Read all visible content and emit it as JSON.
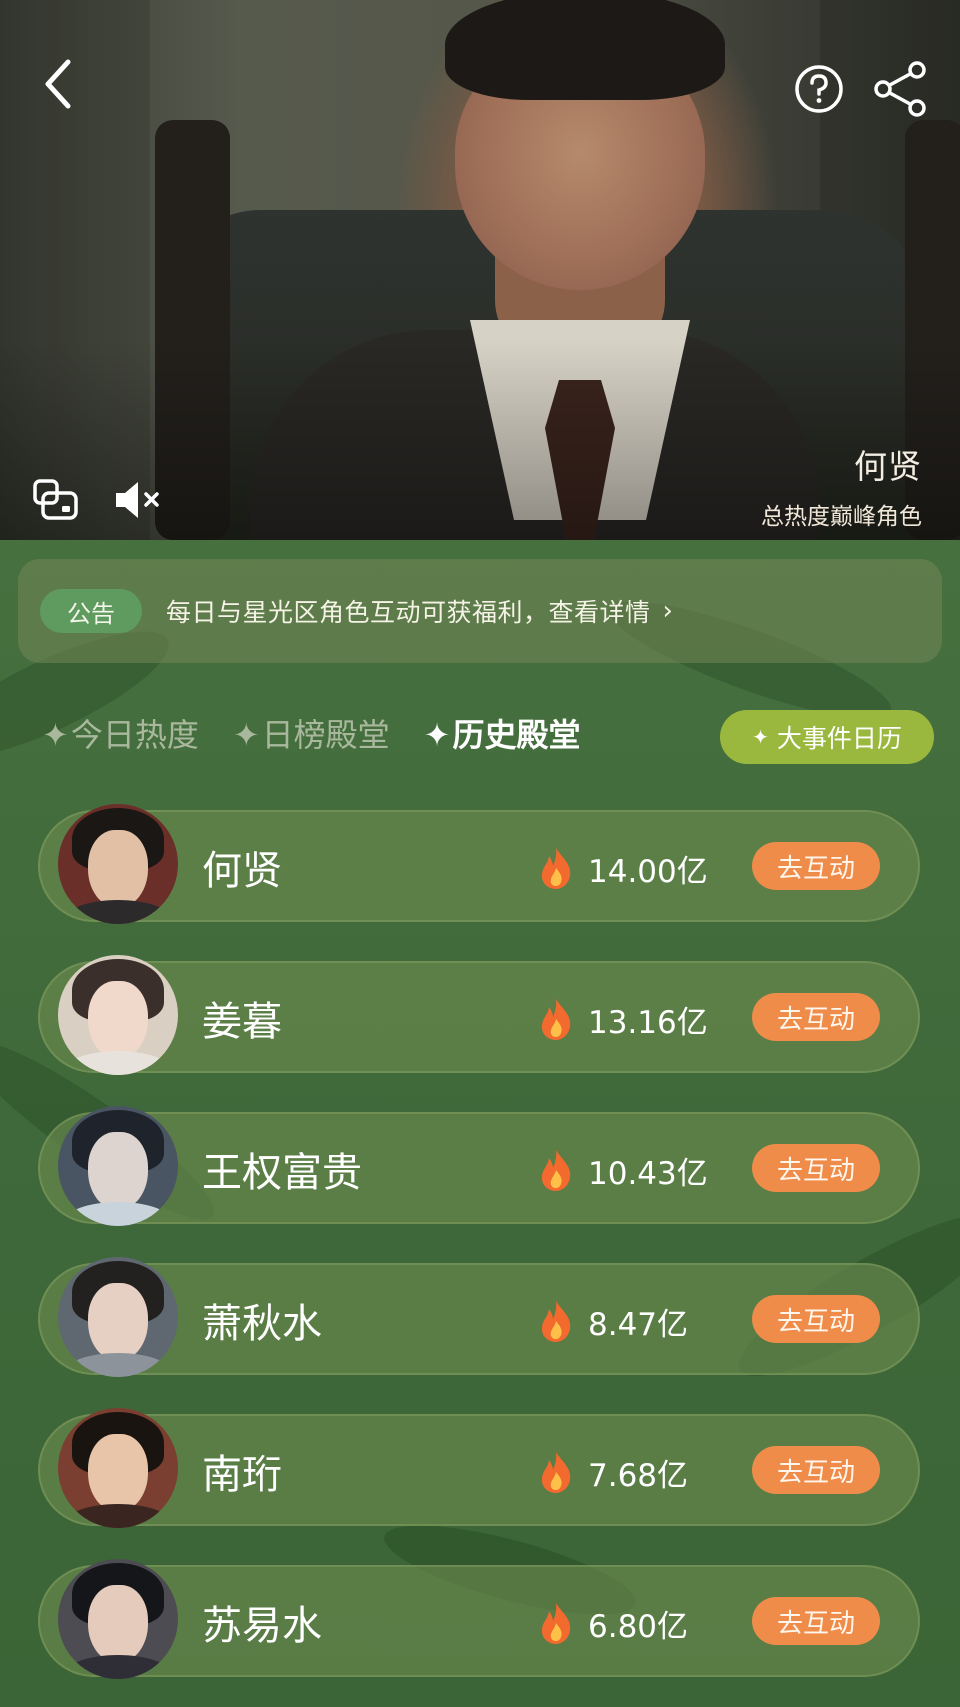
{
  "hero": {
    "character_name": "何贤",
    "subtitle": "总热度巅峰角色"
  },
  "notice": {
    "tag": "公告",
    "text": "每日与星光区角色互动可获福利，查看详情",
    "chevron": "›"
  },
  "tabs": [
    {
      "spark": "✦",
      "label": "今日热度",
      "active": false
    },
    {
      "spark": "✦",
      "label": "日榜殿堂",
      "active": false
    },
    {
      "spark": "✦",
      "label": "历史殿堂",
      "active": true
    }
  ],
  "calendar_button": {
    "spark": "✦",
    "label": "大事件日历"
  },
  "ranking": [
    {
      "name": "何贤",
      "heat": "14.00亿",
      "action": "去互动"
    },
    {
      "name": "姜暮",
      "heat": "13.16亿",
      "action": "去互动"
    },
    {
      "name": "王权富贵",
      "heat": "10.43亿",
      "action": "去互动"
    },
    {
      "name": "萧秋水",
      "heat": "8.47亿",
      "action": "去互动"
    },
    {
      "name": "南珩",
      "heat": "7.68亿",
      "action": "去互动"
    },
    {
      "name": "苏易水",
      "heat": "6.80亿",
      "action": "去互动"
    }
  ],
  "colors": {
    "accent_button": "#f08c4a",
    "calendar_button": "#9ab83e",
    "panel_green": "#47703f"
  },
  "icons": [
    "back-arrow-icon",
    "help-icon",
    "share-icon",
    "pip-icon",
    "mute-icon",
    "flame-icon"
  ]
}
